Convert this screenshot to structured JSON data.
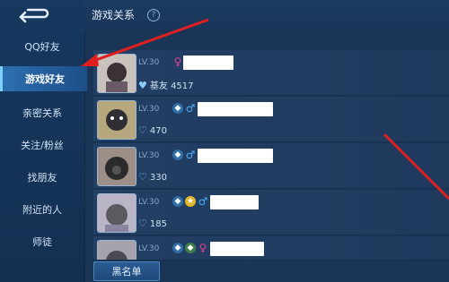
{
  "header": {
    "title": "游戏关系",
    "help_icon": "?"
  },
  "sidebar": {
    "items": [
      {
        "label": "QQ好友",
        "active": false
      },
      {
        "label": "游戏好友",
        "active": true
      },
      {
        "label": "亲密关系",
        "active": false
      },
      {
        "label": "关注/粉丝",
        "active": false
      },
      {
        "label": "找朋友",
        "active": false
      },
      {
        "label": "附近的人",
        "active": false
      },
      {
        "label": "师徒",
        "active": false
      }
    ]
  },
  "friends": [
    {
      "level": "LV.30",
      "gender": "female",
      "stat_label": "基友",
      "stat_value": "4517"
    },
    {
      "level": "LV.30",
      "gender": "male",
      "stat_value": "470"
    },
    {
      "level": "LV.30",
      "gender": "male",
      "stat_value": "330"
    },
    {
      "level": "LV.30",
      "gender": "male",
      "stat_value": "185"
    },
    {
      "level": "LV.30",
      "gender": "female",
      "stat_value": ""
    }
  ],
  "footer": {
    "blacklist_label": "黑名单"
  },
  "colors": {
    "accent": "#2c6fb0",
    "annotation_arrow": "#e02020",
    "female": "#e23d9a",
    "male": "#4ab2ff"
  }
}
